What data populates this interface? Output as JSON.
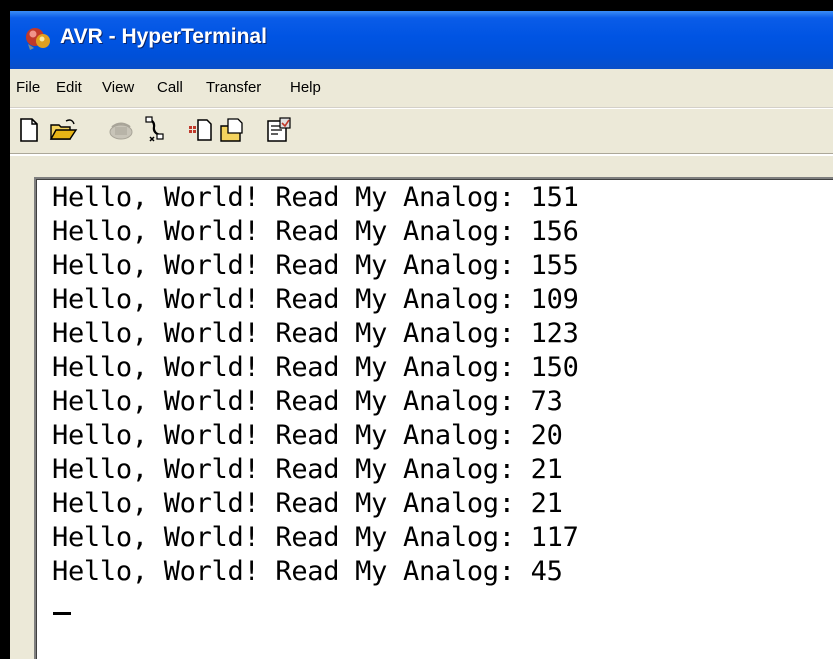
{
  "window": {
    "title": "AVR - HyperTerminal",
    "title_bar_color": "#0054e3"
  },
  "menu": {
    "items": [
      "File",
      "Edit",
      "View",
      "Call",
      "Transfer",
      "Help"
    ]
  },
  "toolbar": {
    "buttons": [
      {
        "name": "new-connection-icon"
      },
      {
        "name": "open-icon"
      },
      {
        "name": "call-icon"
      },
      {
        "name": "disconnect-icon"
      },
      {
        "name": "send-icon"
      },
      {
        "name": "receive-icon"
      },
      {
        "name": "properties-icon"
      }
    ]
  },
  "terminal": {
    "lines": [
      "Hello, World! Read My Analog: 151",
      "Hello, World! Read My Analog: 156",
      "Hello, World! Read My Analog: 155",
      "Hello, World! Read My Analog: 109",
      "Hello, World! Read My Analog: 123",
      "Hello, World! Read My Analog: 150",
      "Hello, World! Read My Analog: 73",
      "Hello, World! Read My Analog: 20",
      "Hello, World! Read My Analog: 21",
      "Hello, World! Read My Analog: 21",
      "Hello, World! Read My Analog: 117",
      "Hello, World! Read My Analog: 45"
    ],
    "cursor": "_"
  }
}
